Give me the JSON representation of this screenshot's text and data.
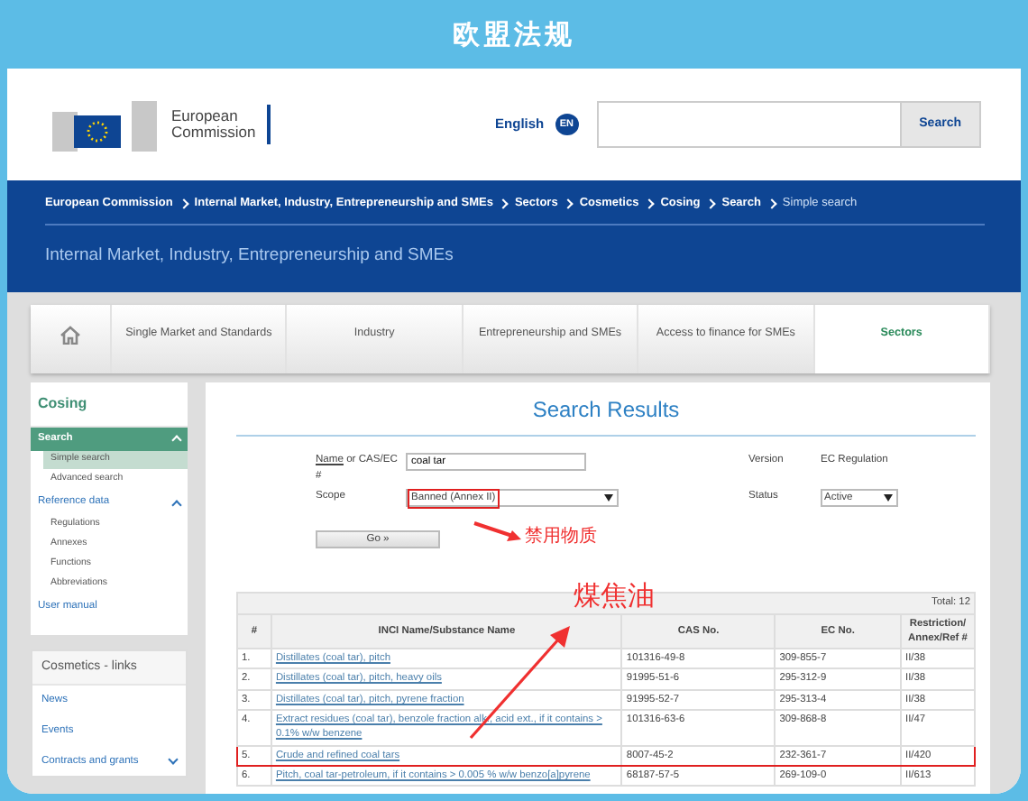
{
  "frame": {
    "title": "欧盟法规"
  },
  "header": {
    "logo_text": "European Commission",
    "language": "English",
    "language_badge": "EN",
    "search_button": "Search"
  },
  "breadcrumb": [
    {
      "label": "European Commission",
      "current": false
    },
    {
      "label": "Internal Market, Industry, Entrepreneurship and SMEs",
      "current": false
    },
    {
      "label": "Sectors",
      "current": false
    },
    {
      "label": "Cosmetics",
      "current": false
    },
    {
      "label": "Cosing",
      "current": false
    },
    {
      "label": "Search",
      "current": false
    },
    {
      "label": "Simple search",
      "current": true
    }
  ],
  "site_title": "Internal Market, Industry, Entrepreneurship and SMEs",
  "nav_tabs": [
    {
      "kind": "home",
      "selected": false
    },
    {
      "kind": "text",
      "label": "Single Market and Standards",
      "selected": false
    },
    {
      "kind": "text",
      "label": "Industry",
      "selected": false
    },
    {
      "kind": "text",
      "label": "Entrepreneurship and SMEs",
      "selected": false
    },
    {
      "kind": "text",
      "label": "Access to finance for SMEs",
      "selected": false
    },
    {
      "kind": "text",
      "label": "Sectors",
      "selected": true
    }
  ],
  "sidebar": {
    "title": "Cosing",
    "sections": [
      {
        "kind": "header",
        "label": "Search",
        "expanded": true,
        "children": [
          {
            "label": "Simple search",
            "selected": true
          },
          {
            "label": "Advanced search",
            "selected": false
          }
        ]
      },
      {
        "kind": "link",
        "label": "Reference data",
        "expanded": true,
        "children": [
          {
            "label": "Regulations",
            "selected": false
          },
          {
            "label": "Annexes",
            "selected": false
          },
          {
            "label": "Functions",
            "selected": false
          },
          {
            "label": "Abbreviations",
            "selected": false
          }
        ]
      },
      {
        "kind": "plain",
        "label": "User manual"
      }
    ]
  },
  "links_card": {
    "title": "Cosmetics - links",
    "items": [
      {
        "label": "News"
      },
      {
        "label": "Events"
      },
      {
        "label": "Contracts and grants",
        "expanded": false
      }
    ]
  },
  "search_form": {
    "name_link": "Name",
    "name_label": "or CAS/EC #",
    "name_value": "coal tar",
    "scope_label": "Scope",
    "scope_value": "Banned (Annex II)",
    "scope_highlighted": true,
    "version_label": "Version",
    "version_value": "EC Regulation",
    "status_label": "Status",
    "status_value": "Active",
    "go_button": "Go »"
  },
  "results": {
    "title": "Search Results",
    "total": "Total: 12",
    "columns": [
      "#",
      "INCI Name/Substance Name",
      "CAS No.",
      "EC No.",
      "Restriction/ Annex/Ref #"
    ],
    "rows": [
      {
        "number": "1.",
        "name": "Distillates (coal tar), pitch",
        "cas": "101316-49-8",
        "ec": "309-855-7",
        "ref": "II/38",
        "highlighted": false
      },
      {
        "number": "2.",
        "name": "Distillates (coal tar), pitch, heavy oils",
        "cas": "91995-51-6",
        "ec": "295-312-9",
        "ref": "II/38",
        "highlighted": false
      },
      {
        "number": "3.",
        "name": "Distillates (coal tar), pitch, pyrene fraction",
        "cas": "91995-52-7",
        "ec": "295-313-4",
        "ref": "II/38",
        "highlighted": false
      },
      {
        "number": "4.",
        "name": "Extract residues (coal tar), benzole fraction alk., acid ext., if it contains > 0.1% w/w benzene",
        "cas": "101316-63-6",
        "ec": "309-868-8",
        "ref": "II/47",
        "highlighted": false
      },
      {
        "number": "5.",
        "name": "Crude and refined coal tars",
        "cas": "8007-45-2",
        "ec": "232-361-7",
        "ref": "II/420",
        "highlighted": true
      },
      {
        "number": "6.",
        "name": "Pitch, coal tar-petroleum, if it contains > 0.005 % w/w benzo[a]pyrene",
        "cas": "68187-57-5",
        "ec": "269-109-0",
        "ref": "II/613",
        "highlighted": false
      }
    ]
  },
  "annotations": [
    {
      "kind": "scope",
      "text": "禁用物质"
    },
    {
      "kind": "row",
      "text": "煤焦油"
    }
  ]
}
